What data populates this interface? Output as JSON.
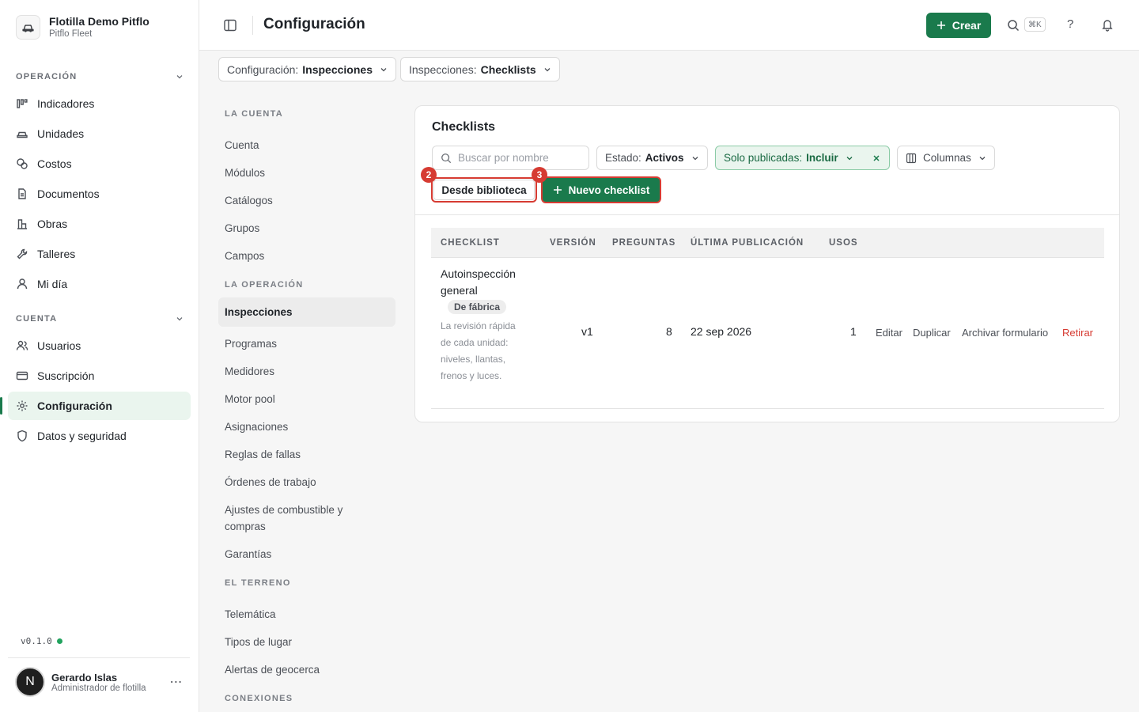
{
  "org": {
    "name": "Flotilla Demo Pitflo",
    "subtitle": "Pitflo Fleet"
  },
  "sidebar": {
    "sections": [
      {
        "label": "OPERACIÓN",
        "items": [
          "Indicadores",
          "Unidades",
          "Costos",
          "Documentos",
          "Obras",
          "Talleres",
          "Mi día"
        ]
      },
      {
        "label": "CUENTA",
        "items": [
          "Usuarios",
          "Suscripción",
          "Configuración",
          "Datos y seguridad"
        ]
      }
    ],
    "active": "Configuración",
    "version": "v0.1.0",
    "user": {
      "initial": "N",
      "name": "Gerardo Islas",
      "role": "Administrador de flotilla"
    }
  },
  "topbar": {
    "title": "Configuración",
    "create_label": "Crear",
    "shortcut": "⌘K",
    "help": "?"
  },
  "breadcrumbs": [
    {
      "prefix": "Configuración:",
      "value": "Inspecciones"
    },
    {
      "prefix": "Inspecciones:",
      "value": "Checklists"
    }
  ],
  "settings_nav": {
    "groups": [
      {
        "label": "LA CUENTA",
        "items": [
          "Cuenta",
          "Módulos",
          "Catálogos",
          "Grupos",
          "Campos"
        ]
      },
      {
        "label": "LA OPERACIÓN",
        "items": [
          "Inspecciones",
          "Programas",
          "Medidores",
          "Motor pool",
          "Asignaciones",
          "Reglas de fallas",
          "Órdenes de trabajo",
          "Ajustes de combustible y compras",
          "Garantías"
        ]
      },
      {
        "label": "EL TERRENO",
        "items": [
          "Telemática",
          "Tipos de lugar",
          "Alertas de geocerca"
        ]
      },
      {
        "label": "CONEXIONES",
        "items": []
      }
    ],
    "active": "Inspecciones"
  },
  "card": {
    "title": "Checklists",
    "search_placeholder": "Buscar por nombre",
    "filters": {
      "estado": {
        "prefix": "Estado:",
        "value": "Activos"
      },
      "publicadas": {
        "prefix": "Solo publicadas:",
        "value": "Incluir"
      },
      "columnas": "Columnas"
    },
    "btn_library": "Desde biblioteca",
    "btn_new": "Nuevo checklist",
    "badges": [
      "2",
      "3"
    ],
    "columns": [
      "CHECKLIST",
      "VERSIÓN",
      "PREGUNTAS",
      "ÚLTIMA PUBLICACIÓN",
      "USOS"
    ],
    "rows": [
      {
        "name": "Autoinspección general",
        "tag": "De fábrica",
        "description": "La revisión rápida de cada unidad: niveles, llantas, frenos y luces.",
        "version": "v1",
        "questions": "8",
        "last_published": "22 sep 2026",
        "uses": "1",
        "actions": [
          "Editar",
          "Duplicar",
          "Archivar formulario",
          "Retirar"
        ]
      }
    ]
  },
  "colors": {
    "accent": "#1a7a4c",
    "danger": "#d63b32",
    "active_bg": "#eaf5ee"
  }
}
